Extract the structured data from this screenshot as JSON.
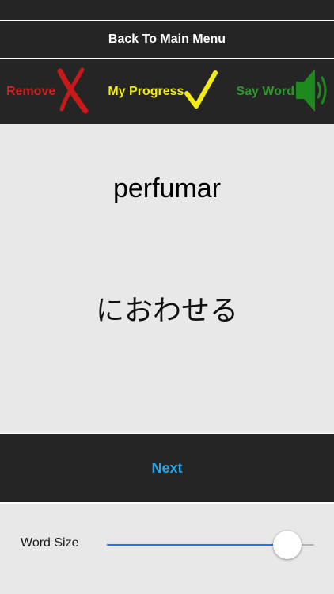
{
  "menu": {
    "back_label": "Back To Main Menu"
  },
  "actions": {
    "remove": {
      "label": "Remove",
      "icon": "x-mark-icon",
      "color": "#d22121"
    },
    "progress": {
      "label": "My Progress",
      "icon": "checkmark-icon",
      "color": "#f3ec10"
    },
    "say": {
      "label": "Say Word",
      "icon": "speaker-icon",
      "color": "#2a9a2a"
    }
  },
  "card": {
    "word": "perfumar",
    "translation": "におわせる"
  },
  "navigation": {
    "next_label": "Next",
    "color": "#2aa3e6"
  },
  "word_size": {
    "label": "Word Size",
    "value": 0.93,
    "fill_color": "#1a73e8"
  }
}
